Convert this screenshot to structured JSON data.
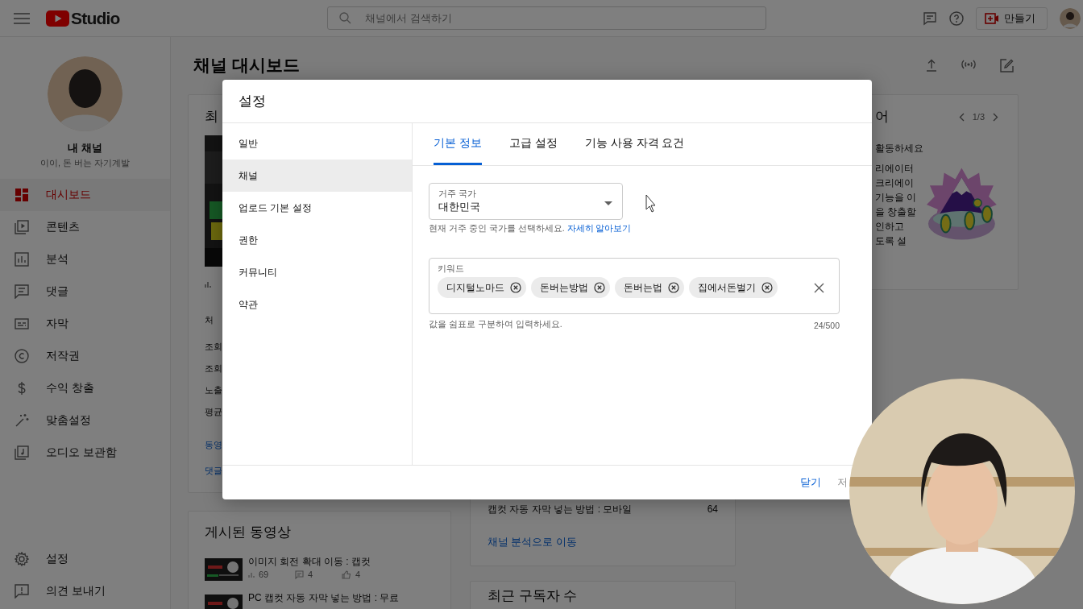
{
  "topbar": {
    "logo": "Studio",
    "search": {
      "placeholder": "채널에서 검색하기"
    },
    "create_button": "만들기"
  },
  "sidebar": {
    "channel_title": "내 채널",
    "channel_name": "이이, 돈 버는 자기계발",
    "items": [
      {
        "label": "대시보드",
        "selected": true
      },
      {
        "label": "콘텐츠",
        "selected": false
      },
      {
        "label": "분석",
        "selected": false
      },
      {
        "label": "댓글",
        "selected": false
      },
      {
        "label": "자막",
        "selected": false
      },
      {
        "label": "저작권",
        "selected": false
      },
      {
        "label": "수익 창출",
        "selected": false
      },
      {
        "label": "맞춤설정",
        "selected": false
      },
      {
        "label": "오디오 보관함",
        "selected": false
      }
    ],
    "bottom_items": [
      {
        "label": "설정",
        "selected": false
      },
      {
        "label": "의견 보내기",
        "selected": false
      }
    ]
  },
  "page": {
    "title": "채널 대시보드"
  },
  "latest_card": {
    "title": "최",
    "first_row": "처",
    "rows": [
      "조회",
      "조회",
      "노출",
      "평균"
    ],
    "links": [
      "동영",
      "댓글"
    ]
  },
  "published_card": {
    "title": "게시된 동영상",
    "videos": [
      {
        "title": "이미지 회전 확대 이동 : 캡컷",
        "views": "69",
        "comments": "4",
        "likes": "4"
      },
      {
        "title": "PC 캡컷 자동 자막 넣는 방법 : 무료"
      }
    ]
  },
  "analytics_card": {
    "rows": [
      {
        "title": "캡컷 자동 자막 넣는 방법 : 모바일",
        "value": "64"
      }
    ],
    "link": "채널 분석으로 이동"
  },
  "subscribers_card": {
    "title": "최근 구독자 수"
  },
  "ideas_card": {
    "title": "어",
    "pager": "1/3",
    "heading": "활동하세요",
    "lines": [
      "리에이터",
      "크리에이",
      "기능을 이",
      "을 창출할",
      "인하고",
      "도록 설"
    ]
  },
  "modal": {
    "title": "설정",
    "nav": [
      {
        "label": "일반",
        "selected": false
      },
      {
        "label": "채널",
        "selected": true
      },
      {
        "label": "업로드 기본 설정",
        "selected": false
      },
      {
        "label": "권한",
        "selected": false
      },
      {
        "label": "커뮤니티",
        "selected": false
      },
      {
        "label": "약관",
        "selected": false
      }
    ],
    "tabs": [
      {
        "label": "기본 정보",
        "selected": true
      },
      {
        "label": "고급 설정",
        "selected": false
      },
      {
        "label": "기능 사용 자격 요건",
        "selected": false
      }
    ],
    "country": {
      "label": "거주 국가",
      "value": "대한민국",
      "helper": "현재 거주 중인 국가를 선택하세요.",
      "link": "자세히 알아보기"
    },
    "keywords": {
      "label": "키워드",
      "chips": [
        "디지털노마드",
        "돈버는방법",
        "돈버는법",
        "집에서돈벌기"
      ],
      "helper": "값을 쉼표로 구분하여 입력하세요.",
      "counter": "24/500"
    },
    "buttons": [
      {
        "label": "닫기",
        "disabled": false
      },
      {
        "label": "저",
        "disabled": true
      }
    ]
  }
}
